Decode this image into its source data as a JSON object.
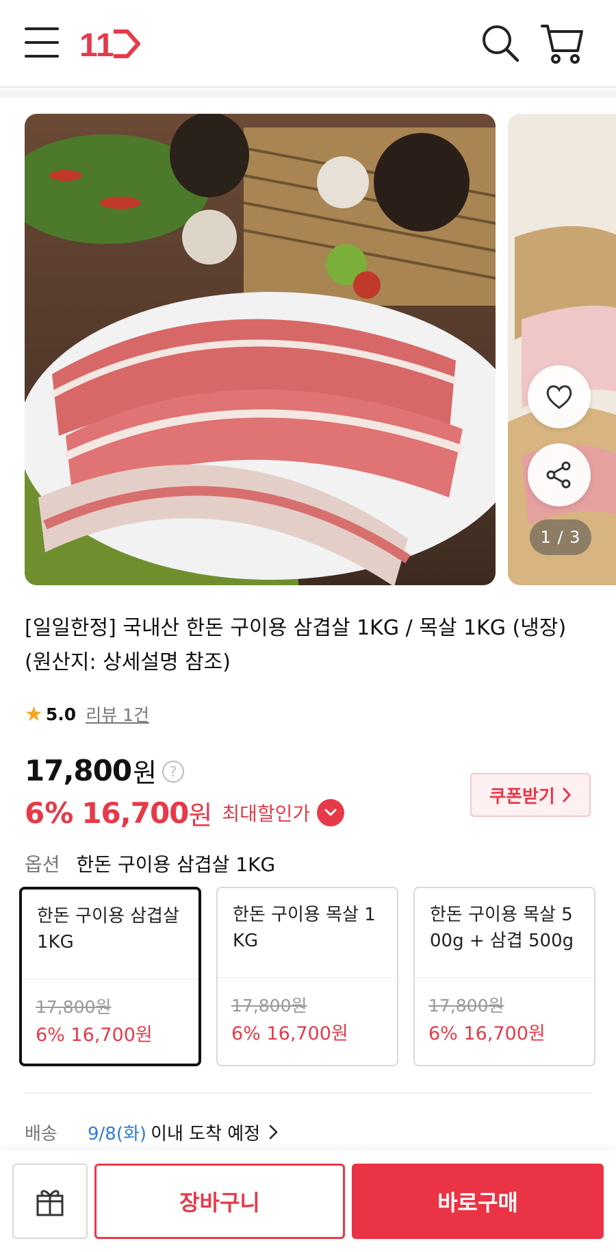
{
  "header": {
    "logo_text": "11",
    "icons": [
      "menu-icon",
      "search-icon",
      "cart-icon"
    ]
  },
  "gallery": {
    "counter": "1 / 3",
    "icons": [
      "heart-icon",
      "share-icon"
    ]
  },
  "product": {
    "title": "[일일한정] 국내산 한돈 구이용 삼겹살 1KG / 목살 1KG (냉장) (원산지: 상세설명 참조)",
    "rating": "5.0",
    "review_link": "리뷰 1건",
    "price": "17,800",
    "price_unit": "원",
    "discount_pct": "6%",
    "sale_price": "16,700",
    "sale_unit": "원",
    "max_discount_label": "최대할인가",
    "coupon_label": "쿠폰받기"
  },
  "options": {
    "label": "옵션",
    "selected": "한돈 구이용 삼겹살 1KG",
    "items": [
      {
        "name": "한돈 구이용 삼겹살 1KG",
        "original": "17,800원",
        "sale": "6% 16,700원"
      },
      {
        "name": "한돈 구이용 목살 1KG",
        "original": "17,800원",
        "sale": "6% 16,700원"
      },
      {
        "name": "한돈 구이용 목살 500g + 삼겹 500g",
        "original": "17,800원",
        "sale": "6% 16,700원"
      }
    ]
  },
  "shipping": {
    "label": "배송",
    "date": "9/8(화)",
    "text": "이내 도착 예정"
  },
  "bottom": {
    "cart_label": "장바구니",
    "buy_label": "바로구매"
  },
  "colors": {
    "accent": "#e63a48",
    "link_blue": "#2f7bd6",
    "star": "#f5a623"
  }
}
